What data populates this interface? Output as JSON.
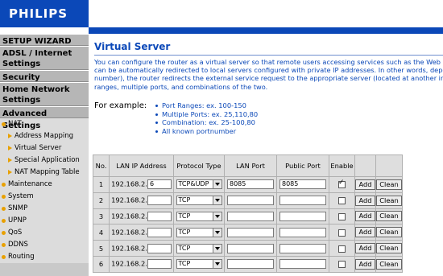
{
  "brand": "PHILIPS",
  "sidebar": {
    "sections": [
      "SETUP WIZARD",
      "ADSL / Internet Settings",
      "Security",
      "Home Network Settings",
      "Advanced Settings"
    ],
    "nat": "NAT",
    "nat_items": [
      "Address Mapping",
      "Virtual Server",
      "Special Application",
      "NAT Mapping Table"
    ],
    "items": [
      "Maintenance",
      "System",
      "SNMP",
      "UPNP",
      "QoS",
      "DDNS",
      "Routing"
    ]
  },
  "page": {
    "title": "Virtual Server",
    "desc_lines": [
      "You can configure the router as a virtual server so that remote users accessing services such as the Web o",
      "can be automatically redirected to local servers configured with private IP addresses. In other words, depe",
      "number), the router redirects the external service request to the appropriate server (located at another int",
      "ranges, multiple ports, and combinations of the two."
    ],
    "for_example": "For example:",
    "examples": [
      "Port Ranges: ex. 100-150",
      "Multiple Ports: ex. 25,110,80",
      "Combination: ex. 25-100,80",
      "All known portnumber"
    ]
  },
  "table": {
    "headers": [
      "No.",
      "LAN IP Address",
      "Protocol Type",
      "LAN Port",
      "Public Port",
      "Enable",
      "",
      ""
    ],
    "ip_prefix": "192.168.2.",
    "add_label": "Add",
    "clean_label": "Clean",
    "rows": [
      {
        "no": "1",
        "ip": "6",
        "protocol": "TCP&UDP",
        "lan_port": "8085",
        "public_port": "8085",
        "enabled": true
      },
      {
        "no": "2",
        "ip": "",
        "protocol": "TCP",
        "lan_port": "",
        "public_port": "",
        "enabled": false
      },
      {
        "no": "3",
        "ip": "",
        "protocol": "TCP",
        "lan_port": "",
        "public_port": "",
        "enabled": false
      },
      {
        "no": "4",
        "ip": "",
        "protocol": "TCP",
        "lan_port": "",
        "public_port": "",
        "enabled": false
      },
      {
        "no": "5",
        "ip": "",
        "protocol": "TCP",
        "lan_port": "",
        "public_port": "",
        "enabled": false
      },
      {
        "no": "6",
        "ip": "",
        "protocol": "TCP",
        "lan_port": "",
        "public_port": "",
        "enabled": false
      }
    ]
  },
  "colors": {
    "brand_blue": "#0b48b8",
    "sidebar_gray": "#c9c9c9",
    "bullet_orange": "#e8a000"
  }
}
